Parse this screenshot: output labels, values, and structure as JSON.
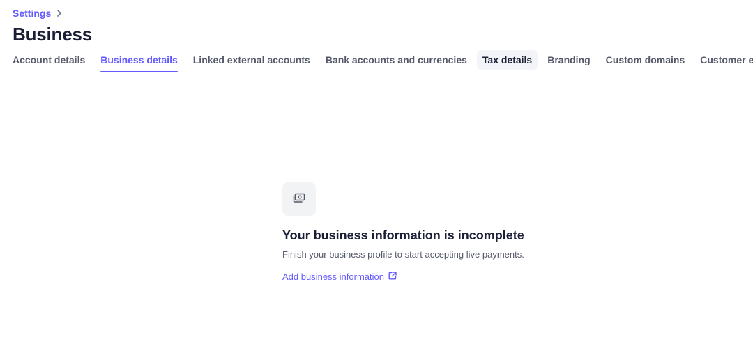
{
  "breadcrumb": {
    "parent": "Settings"
  },
  "page": {
    "title": "Business"
  },
  "tabs": [
    {
      "label": "Account details"
    },
    {
      "label": "Business details"
    },
    {
      "label": "Linked external accounts"
    },
    {
      "label": "Bank accounts and currencies"
    },
    {
      "label": "Tax details"
    },
    {
      "label": "Branding"
    },
    {
      "label": "Custom domains"
    },
    {
      "label": "Customer emails"
    }
  ],
  "active_tab": "Business details",
  "empty_state": {
    "icon": "money-icon",
    "title": "Your business information is incomplete",
    "description": "Finish your business profile to start accepting live payments.",
    "link_label": "Add business information",
    "link_icon": "external-link-icon"
  },
  "colors": {
    "accent": "#635bff",
    "text": "#1a1f36",
    "muted": "#545969",
    "border": "#e3e8ee"
  }
}
